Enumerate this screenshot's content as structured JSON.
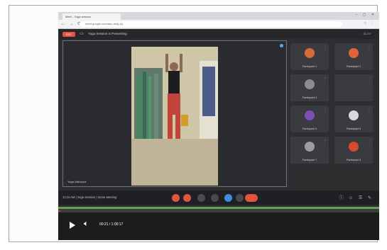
{
  "browser": {
    "tab_title": "Meet - Yoga session",
    "url": "meet.google.com/abc-defg-hij",
    "window_controls": "– ▢ ✕",
    "nav_buttons": "← → ⟳",
    "extension_icons": "☆ ⋮"
  },
  "meet": {
    "rec_label": "REC",
    "title": "Yoga Session is Presenting",
    "header_right": "11:24",
    "main_speaker_name": "Yoga Instructor",
    "meeting_info": "11:24 AM | Yoga Session | Zoom Meeting",
    "participants": [
      {
        "name": "Participant 1",
        "avatar_color": "#d56a3a"
      },
      {
        "name": "Participant 2",
        "avatar_color": "#e0643a"
      },
      {
        "name": "Participant 3",
        "avatar_color": "#8a8c90"
      },
      {
        "name": "",
        "avatar_color": "#3a3b3e"
      },
      {
        "name": "Participant 5",
        "avatar_color": "#7b4fb4"
      },
      {
        "name": "Participant 6",
        "avatar_color": "#d9d9d9"
      },
      {
        "name": "Participant 7",
        "avatar_color": "#9a9ca0"
      },
      {
        "name": "Participant 8",
        "avatar_color": "#d9492e"
      }
    ],
    "controls": [
      {
        "name": "mic-button",
        "color": "#e2543f"
      },
      {
        "name": "camera-button",
        "color": "#e2543f"
      },
      {
        "name": "captions-button",
        "color": "#4a4b4f"
      },
      {
        "name": "hand-button",
        "color": "#4a4b4f"
      },
      {
        "name": "present-button",
        "color": "#3f8edc"
      },
      {
        "name": "more-button",
        "color": "#4a4b4f"
      }
    ],
    "right_icons": "ⓘ ☺ ☰ ✎"
  },
  "player": {
    "time": "00:21 / 1:00:17",
    "progress": 0.006
  }
}
